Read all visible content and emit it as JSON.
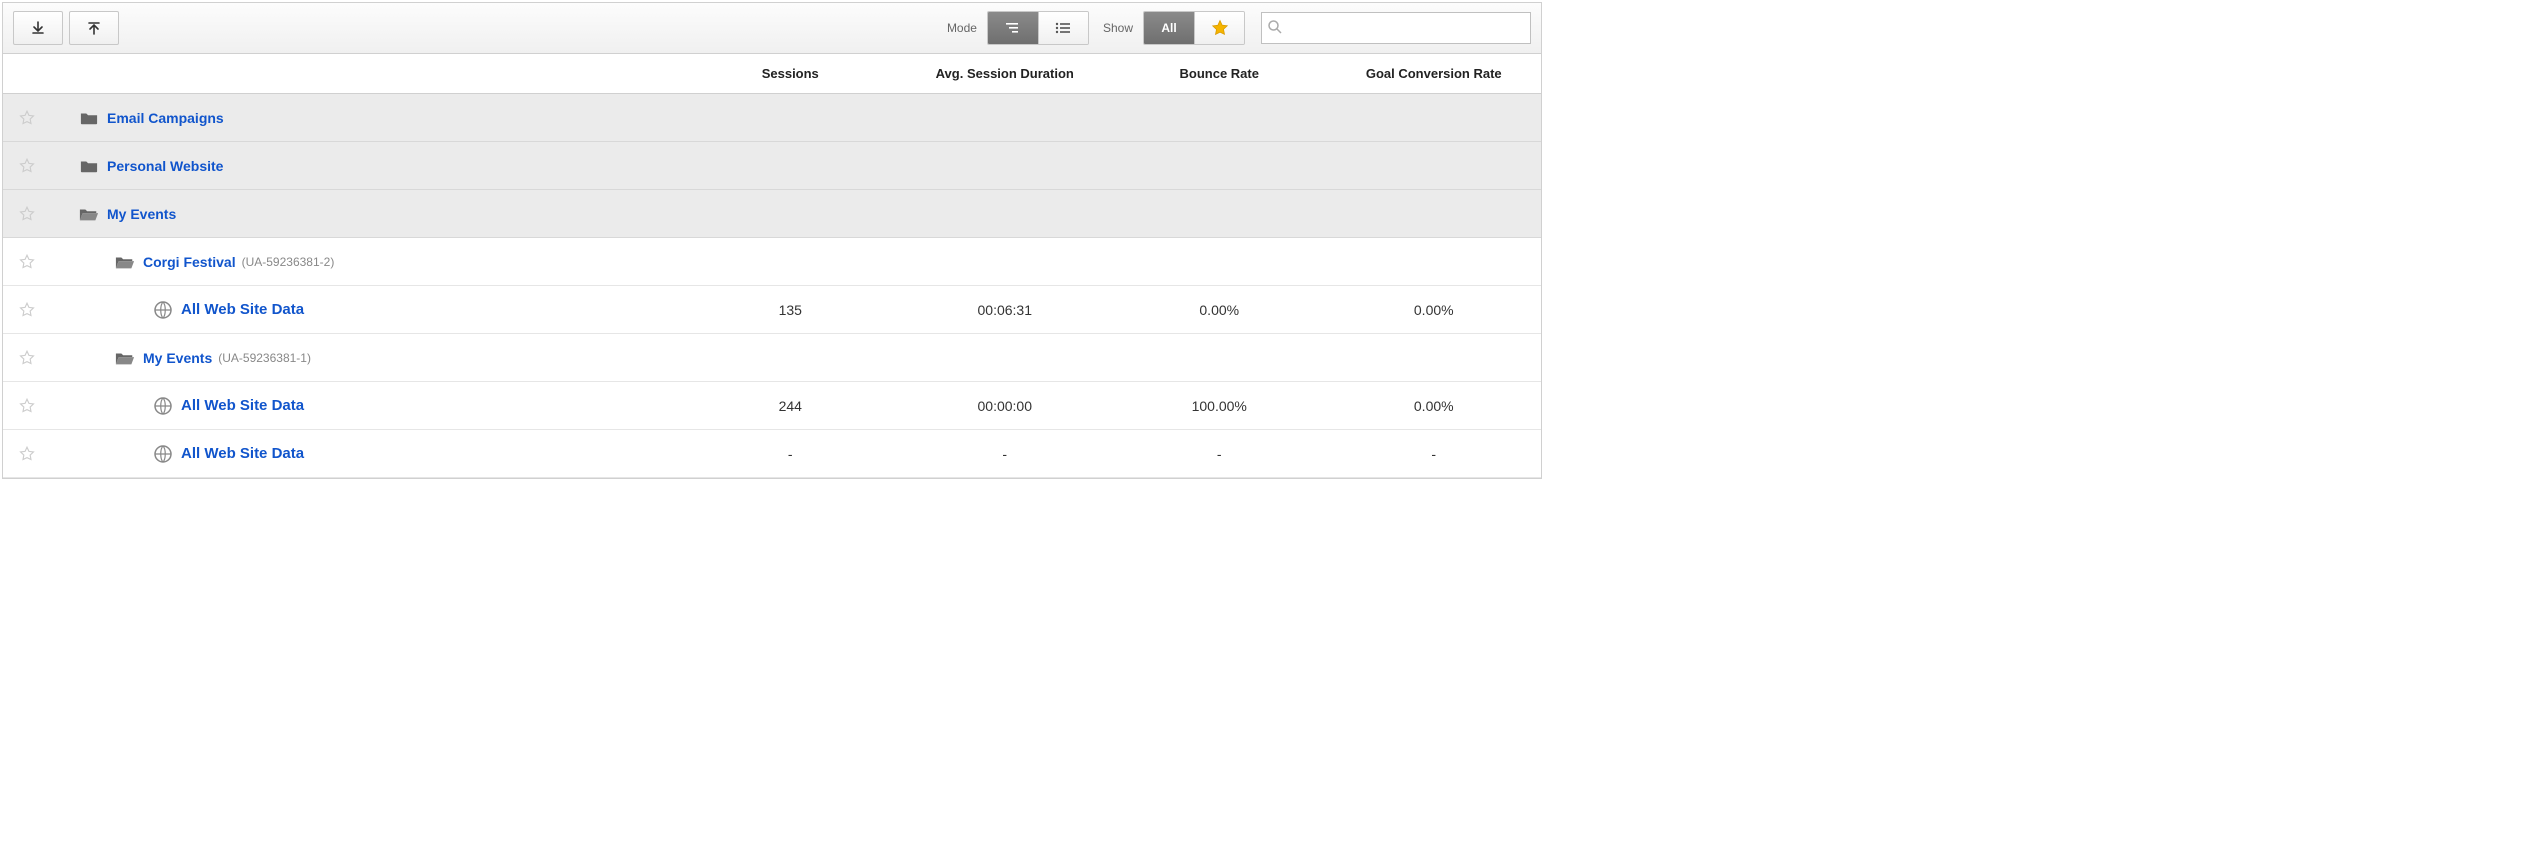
{
  "toolbar": {
    "mode_label": "Mode",
    "show_label": "Show",
    "all_label": "All",
    "search_placeholder": ""
  },
  "columns": {
    "sessions": "Sessions",
    "avg_duration": "Avg. Session Duration",
    "bounce_rate": "Bounce Rate",
    "goal_conv": "Goal Conversion Rate"
  },
  "accounts": [
    {
      "name": "Email Campaigns"
    },
    {
      "name": "Personal Website"
    },
    {
      "name": "My Events"
    }
  ],
  "properties": [
    {
      "name": "Corgi Festival",
      "id": "(UA-59236381-2)"
    },
    {
      "name": "My Events",
      "id": "(UA-59236381-1)"
    }
  ],
  "views": [
    {
      "name": "All Web Site Data",
      "sessions": "135",
      "avg_duration": "00:06:31",
      "bounce_rate": "0.00%",
      "goal_conv": "0.00%"
    },
    {
      "name": "All Web Site Data",
      "sessions": "244",
      "avg_duration": "00:00:00",
      "bounce_rate": "100.00%",
      "goal_conv": "0.00%"
    },
    {
      "name": "All Web Site Data",
      "sessions": "-",
      "avg_duration": "-",
      "bounce_rate": "-",
      "goal_conv": "-"
    }
  ]
}
